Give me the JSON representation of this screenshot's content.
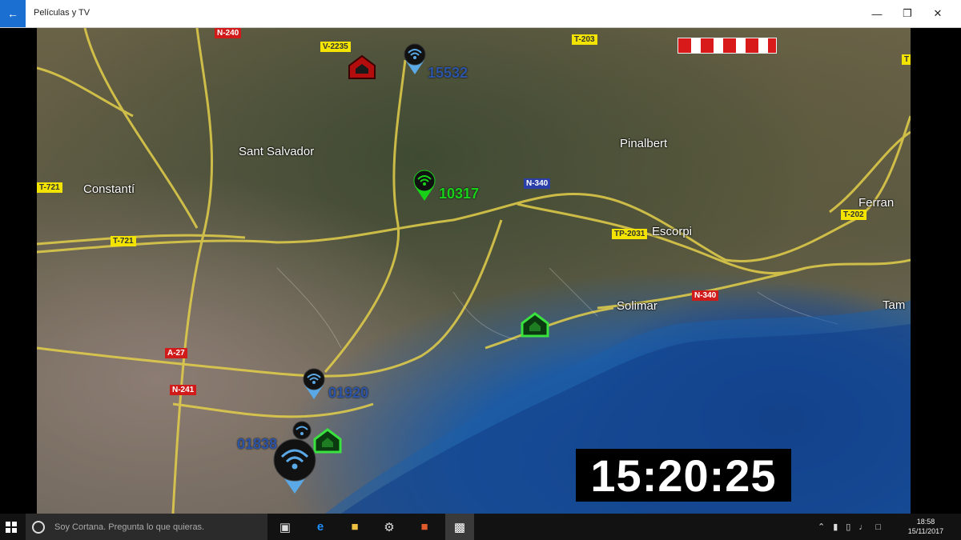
{
  "window": {
    "title": "Películas y TV"
  },
  "map": {
    "places": [
      {
        "name": "Sant Salvador",
        "key": "sant-salvador"
      },
      {
        "name": "Constantí",
        "key": "constanti"
      },
      {
        "name": "Pinalbert",
        "key": "pinalbert"
      },
      {
        "name": "Escorpi",
        "key": "escorpi"
      },
      {
        "name": "Ferran",
        "key": "ferran"
      },
      {
        "name": "Solimar",
        "key": "solimar"
      },
      {
        "name": "Tam",
        "key": "tam"
      }
    ],
    "roads": [
      {
        "label": "N-240",
        "color": "red"
      },
      {
        "label": "V-2235",
        "color": "yellow"
      },
      {
        "label": "T-203",
        "color": "yellow"
      },
      {
        "label": "T-721",
        "color": "yellow"
      },
      {
        "label": "T-721",
        "color": "yellow"
      },
      {
        "label": "N-340",
        "color": "blue"
      },
      {
        "label": "TP-2031",
        "color": "yellow"
      },
      {
        "label": "T-202",
        "color": "yellow"
      },
      {
        "label": "N-340",
        "color": "red"
      },
      {
        "label": "A-27",
        "color": "red"
      },
      {
        "label": "N-241",
        "color": "red"
      },
      {
        "label": "T",
        "color": "yellow"
      }
    ],
    "markers": [
      {
        "id": "15532",
        "color": "#5aa9e6"
      },
      {
        "id": "10317",
        "color": "#18d21a"
      },
      {
        "id": "01920",
        "color": "#5aa9e6"
      },
      {
        "id": "01838",
        "color": "#5aa9e6"
      }
    ]
  },
  "clock": {
    "time": "15:20:25"
  },
  "taskbar": {
    "cortana_placeholder": "Soy Cortana. Pregunta lo que quieras.",
    "tray_time": "18:58",
    "tray_date": "15/11/2017"
  },
  "colors": {
    "accent": "#1a6fd0",
    "sea": "#1d5aa3",
    "road": "#e8d24a",
    "alarm": "#c41414",
    "ok": "#2ecc2e"
  }
}
